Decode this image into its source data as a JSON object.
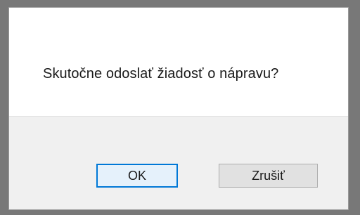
{
  "dialog": {
    "message": "Skutočne odoslať žiadosť o nápravu?",
    "ok_label": "OK",
    "cancel_label": "Zrušiť"
  },
  "colors": {
    "dialog_background": "#ffffff",
    "button_area_background": "#f0f0f0",
    "default_button_border": "#0078d7",
    "outer_background": "#787878"
  }
}
